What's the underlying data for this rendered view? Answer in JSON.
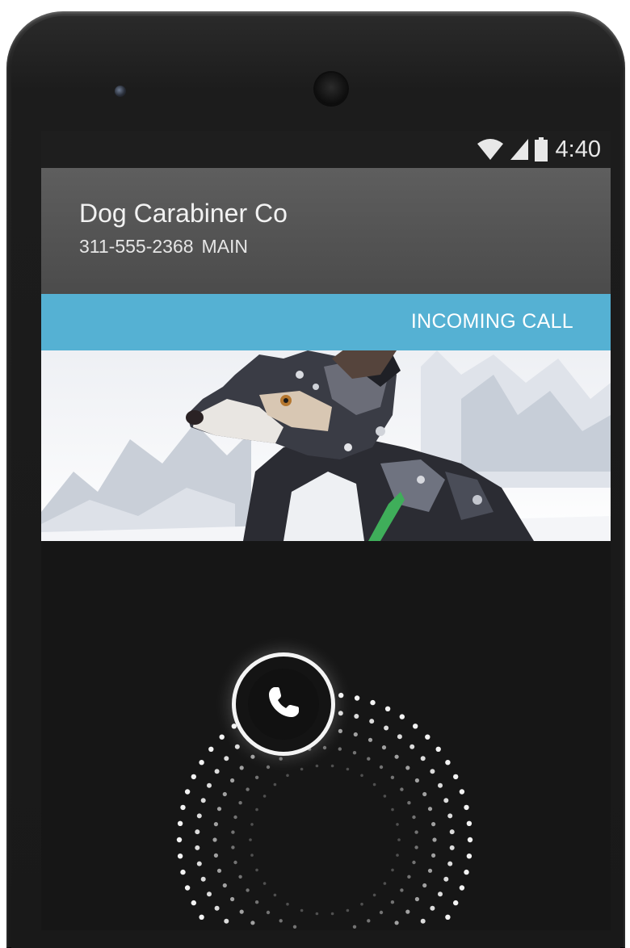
{
  "status_bar": {
    "time": "4:40",
    "icons": [
      "wifi-icon",
      "signal-icon",
      "battery-icon"
    ]
  },
  "call": {
    "caller_name": "Dog Carabiner Co",
    "caller_number": "311-555-2368",
    "number_label": "MAIN",
    "state": "INCOMING CALL"
  },
  "contact_photo": {
    "subject": "dog-in-snow"
  },
  "controls": {
    "answer_icon": "phone-handset-icon"
  },
  "colors": {
    "call_state_bar": "#55b1d3",
    "caller_header": "#545454",
    "screen_background": "#161616",
    "text_primary": "#f2f2f2"
  }
}
